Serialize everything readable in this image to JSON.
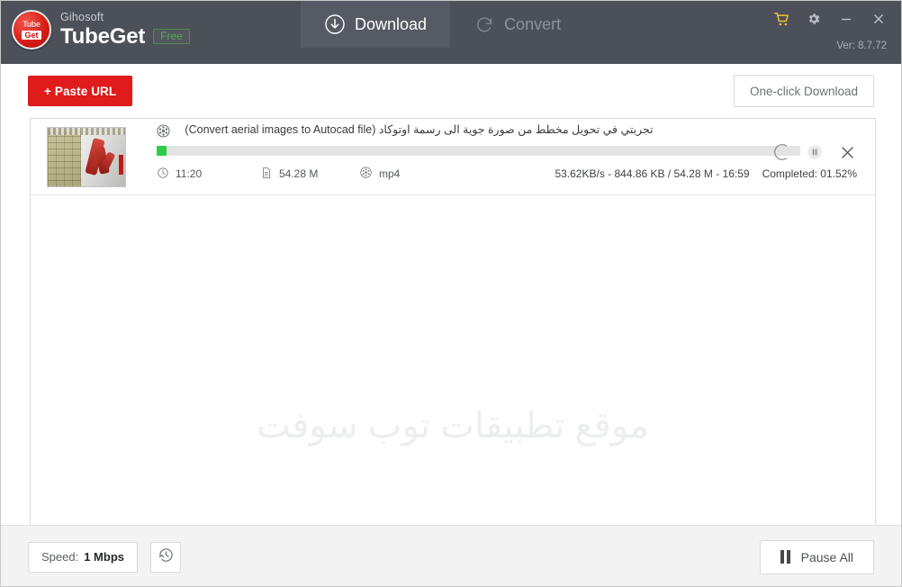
{
  "window": {
    "brand_company": "Gihosoft",
    "brand_product": "TubeGet",
    "brand_badge": "Free",
    "version": "Ver: 8.7.72",
    "logo_top_text": "Tube",
    "logo_bottom_text": "Get",
    "accent_color": "#e01b1b",
    "titlebar_color": "#4c5059",
    "cart_color": "#f0c330"
  },
  "tabs": [
    {
      "label": "Download",
      "icon": "download-circle-icon",
      "active": true
    },
    {
      "label": "Convert",
      "icon": "refresh-circle-icon",
      "active": false
    }
  ],
  "window_controls": [
    {
      "name": "cart-icon",
      "tooltip": "Buy"
    },
    {
      "name": "gear-icon",
      "tooltip": "Settings"
    },
    {
      "name": "minimize-icon",
      "tooltip": "Minimize"
    },
    {
      "name": "close-icon",
      "tooltip": "Close"
    }
  ],
  "toolbar": {
    "paste_url_label": "+ Paste URL",
    "one_click_label": "One-click Download"
  },
  "list": {
    "watermark": "موقع تطبيقات توب سوفت",
    "items": [
      {
        "title": "تجربتي في تحويل مخطط من صورة جوية الى رسمة اوتوكاد (Convert aerial images to Autocad file)",
        "duration": "11:20",
        "size": "54.28 M",
        "format": "mp4",
        "stats": "53.62KB/s - 844.86 KB / 54.28 M - 16:59",
        "completed": "Completed: 01.52%",
        "progress_percent": 1.52,
        "progress_color": "#2ecc49",
        "state": "downloading"
      }
    ]
  },
  "footer": {
    "speed_label": "Speed:",
    "speed_value": "1 Mbps",
    "history_icon": "history-clock-icon",
    "pause_all_label": "Pause All"
  }
}
